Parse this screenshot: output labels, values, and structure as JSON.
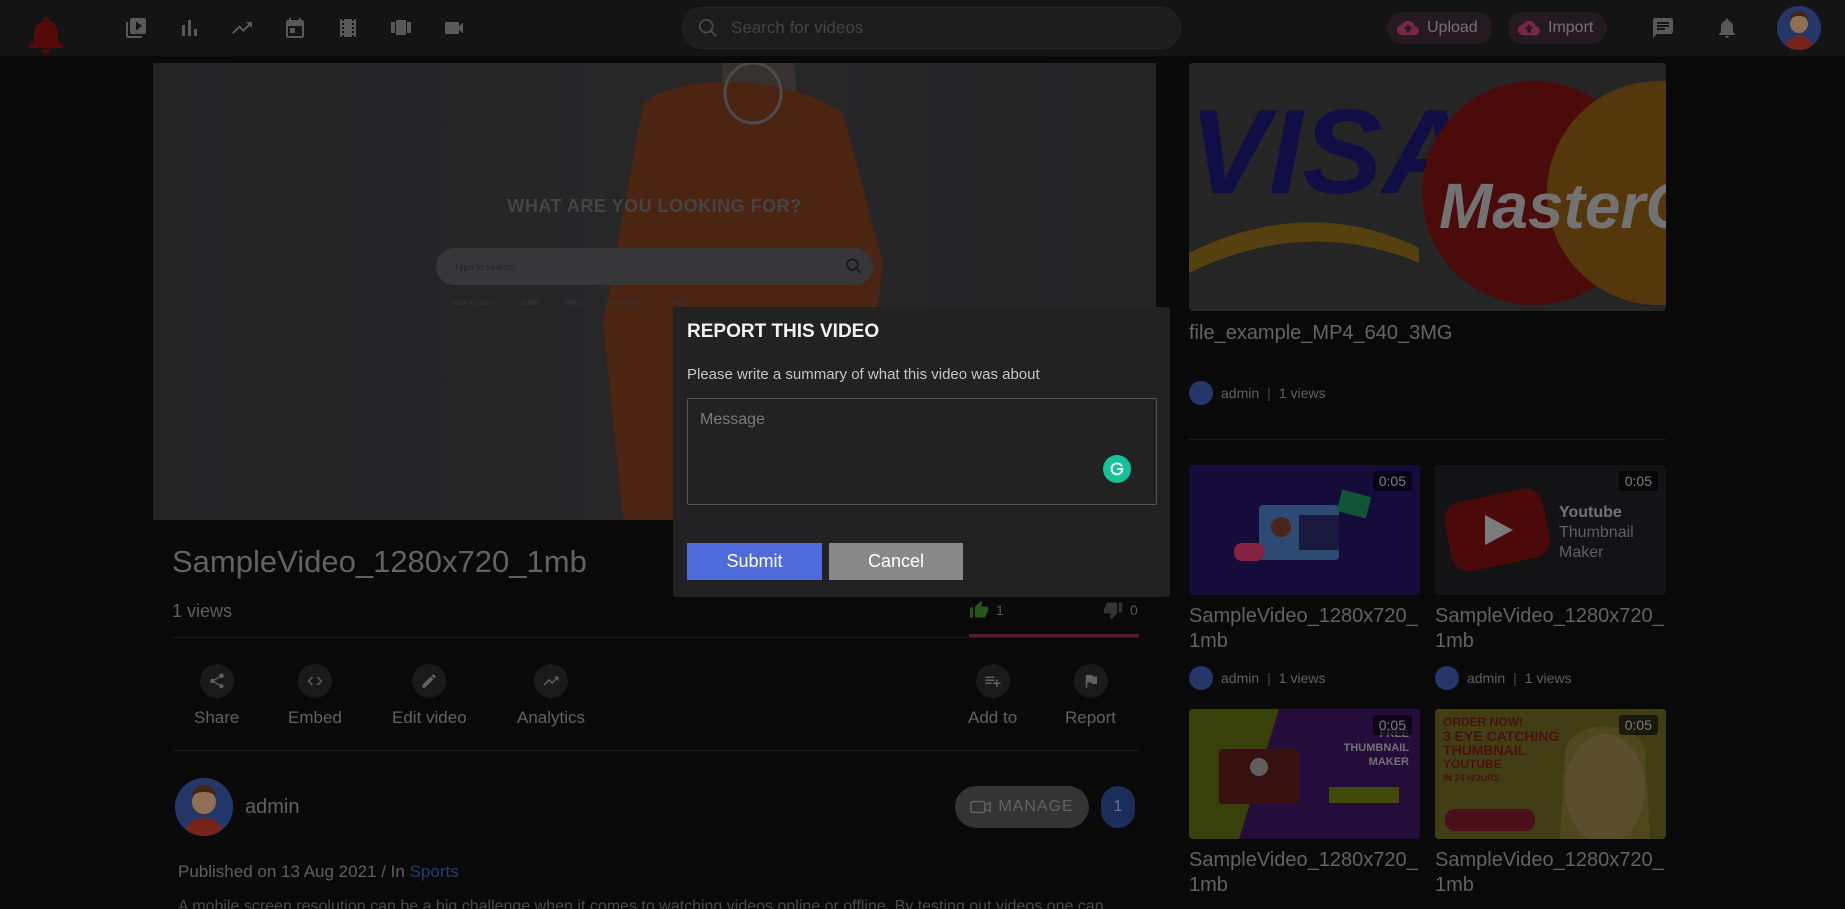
{
  "header": {
    "search_placeholder": "Search for videos",
    "upload_label": "Upload",
    "import_label": "Import",
    "nav_icons": [
      "videos-icon",
      "bar-chart-icon",
      "trending-icon",
      "calendar-icon",
      "film-icon",
      "playlist-icon",
      "camera-icon"
    ]
  },
  "player": {
    "overlay_title": "WHAT ARE YOU LOOKING FOR?",
    "search_placeholder": "Type to search",
    "links": [
      "New Arrivals",
      "Ladies",
      "Mens",
      "Accessories",
      "Sale"
    ]
  },
  "video": {
    "title": "SampleVideo_1280x720_1mb",
    "views": "1 views",
    "likes": "1",
    "dislikes": "0"
  },
  "actions": {
    "share": "Share",
    "embed": "Embed",
    "edit": "Edit video",
    "analytics": "Analytics",
    "add_to": "Add to",
    "report": "Report"
  },
  "channel": {
    "name": "admin",
    "manage_label": "MANAGE",
    "manage_count": "1",
    "published_prefix": "Published on 13 Aug 2021 / In ",
    "category": "Sports",
    "description": "A mobile screen resolution can be a big challenge when it comes to watching videos online or offline. By testing out videos one can"
  },
  "sidebar": {
    "featured": {
      "title": "file_example_MP4_640_3MG",
      "author": "admin",
      "views": "1 views"
    },
    "items": [
      {
        "duration": "0:05",
        "title": "SampleVideo_1280x720_1mb",
        "author": "admin",
        "views": "1 views"
      },
      {
        "duration": "0:05",
        "title": "SampleVideo_1280x720_1mb",
        "author": "admin",
        "views": "1 views",
        "thumb_text": [
          "Youtube",
          "Thumbnail",
          "Maker"
        ]
      },
      {
        "duration": "0:05",
        "title": "SampleVideo_1280x720_1mb",
        "thumb_text": [
          "FREE THUMBNAIL",
          "MAKER"
        ]
      },
      {
        "duration": "0:05",
        "title": "SampleVideo_1280x720_1mb",
        "thumb_text": [
          "ORDER NOW!",
          "3 EYE CATCHING",
          "THUMBNAIL",
          "YOUTUBE",
          "IN 24 HOURS"
        ]
      }
    ]
  },
  "modal": {
    "title": "REPORT THIS VIDEO",
    "subtitle": "Please write a summary of what this video was about",
    "placeholder": "Message",
    "submit": "Submit",
    "cancel": "Cancel"
  }
}
